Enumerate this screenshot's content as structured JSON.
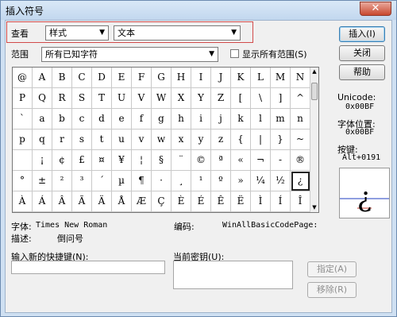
{
  "window": {
    "title": "插入符号",
    "close_glyph": "✕"
  },
  "top": {
    "view_label": "查看",
    "view_value": "样式",
    "style_value": "文本",
    "range_label": "范围",
    "range_value": "所有已知字符",
    "show_all_ranges_label": "显示所有范围(S)"
  },
  "buttons": {
    "insert": "插入(I)",
    "close": "关闭",
    "help": "帮助",
    "assign": "指定(A)",
    "remove": "移除(R)"
  },
  "grid": {
    "cells": [
      [
        "@",
        "A",
        "B",
        "C",
        "D",
        "E",
        "F",
        "G",
        "H",
        "I",
        "J",
        "K",
        "L",
        "M",
        "N"
      ],
      [
        "P",
        "Q",
        "R",
        "S",
        "T",
        "U",
        "V",
        "W",
        "X",
        "Y",
        "Z",
        "[",
        "\\",
        "]",
        "^"
      ],
      [
        "`",
        "a",
        "b",
        "c",
        "d",
        "e",
        "f",
        "g",
        "h",
        "i",
        "j",
        "k",
        "l",
        "m",
        "n"
      ],
      [
        "p",
        "q",
        "r",
        "s",
        "t",
        "u",
        "v",
        "w",
        "x",
        "y",
        "z",
        "{",
        "|",
        "}",
        "~"
      ],
      [
        "",
        "¡",
        "¢",
        "£",
        "¤",
        "¥",
        "¦",
        "§",
        "¨",
        "©",
        "ª",
        "«",
        "¬",
        "-",
        "®"
      ],
      [
        "°",
        "±",
        "²",
        "³",
        "´",
        "µ",
        "¶",
        "·",
        "¸",
        "¹",
        "º",
        "»",
        "¼",
        "½",
        "¿"
      ],
      [
        "À",
        "Á",
        "Â",
        "Ã",
        "Ä",
        "Å",
        "Æ",
        "Ç",
        "È",
        "É",
        "Ê",
        "Ë",
        "Ì",
        "Í",
        "Î"
      ]
    ],
    "extra_right_column": [
      "O",
      "_",
      "o",
      "▯",
      "¯",
      "¾",
      "Ï"
    ],
    "selected": "¿"
  },
  "info": {
    "unicode_label": "Unicode:",
    "unicode_value": "0x00BF",
    "charpos_label": "字体位置:",
    "charpos_value": "0x00BF",
    "keystroke_label": "按键:",
    "keystroke_value": "Alt+0191",
    "font_label": "字体:",
    "font_value": "Times New Roman",
    "encoding_label": "编码:",
    "encoding_value": "WinAllBasicCodePage:",
    "desc_label": "描述:",
    "desc_value": "倒问号"
  },
  "shortcut": {
    "new_label": "输入新的快捷键(N):",
    "current_label": "当前密钥(U):"
  },
  "preview_char": "¿"
}
